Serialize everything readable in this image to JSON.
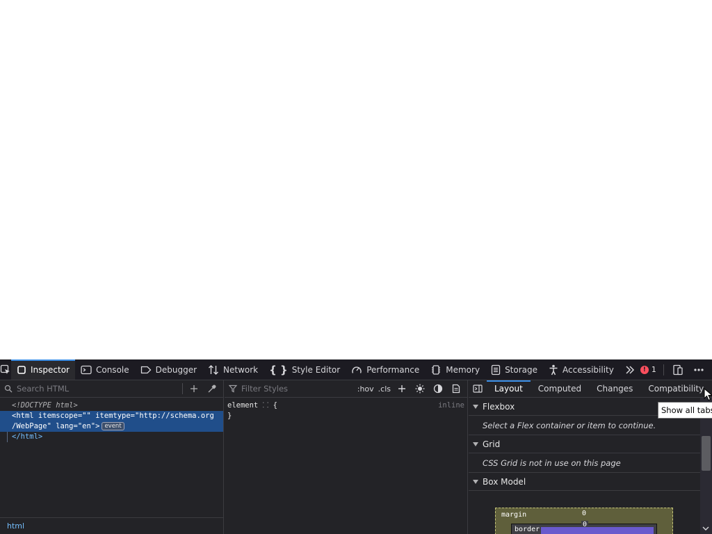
{
  "toolbar": {
    "tabs": [
      {
        "label": "Inspector",
        "icon": "inspector-icon",
        "selected": true
      },
      {
        "label": "Console",
        "icon": "console-icon"
      },
      {
        "label": "Debugger",
        "icon": "debugger-icon"
      },
      {
        "label": "Network",
        "icon": "network-icon"
      },
      {
        "label": "Style Editor",
        "icon": "style-editor-icon"
      },
      {
        "label": "Performance",
        "icon": "performance-icon"
      },
      {
        "label": "Memory",
        "icon": "memory-icon"
      },
      {
        "label": "Storage",
        "icon": "storage-icon"
      },
      {
        "label": "Accessibility",
        "icon": "accessibility-icon"
      }
    ],
    "error_count": "1"
  },
  "markup": {
    "search_placeholder": "Search HTML",
    "doctype": "<!DOCTYPE html>",
    "selected_line1": "<html itemscope=\"\" itemtype=\"http://schema.org",
    "selected_line2": "/WebPage\" lang=\"en\">",
    "event_badge": "event",
    "close_tag": "</html>",
    "breadcrumb": "html"
  },
  "rules": {
    "filter_placeholder": "Filter Styles",
    "hov_label": ":hov",
    "cls_label": ".cls",
    "selector": "element",
    "open_brace": "{",
    "close_brace": "}",
    "source": "inline"
  },
  "sidebar": {
    "tabs": [
      {
        "label": "Layout",
        "selected": true
      },
      {
        "label": "Computed"
      },
      {
        "label": "Changes"
      },
      {
        "label": "Compatibility"
      }
    ],
    "flexbox": {
      "title": "Flexbox",
      "message": "Select a Flex container or item to continue."
    },
    "grid": {
      "title": "Grid",
      "message": "CSS Grid is not in use on this page"
    },
    "box_model": {
      "title": "Box Model",
      "margin_label": "margin",
      "margin_value": "0",
      "border_label": "border",
      "border_value": "0"
    }
  },
  "tooltip": "Show all tabs",
  "colors": {
    "accent": "#3a8ee6",
    "selection": "#204e8a",
    "error": "#ff4f5e",
    "margin_box": "#5f5f3b",
    "padding_box": "#6a5acd"
  }
}
